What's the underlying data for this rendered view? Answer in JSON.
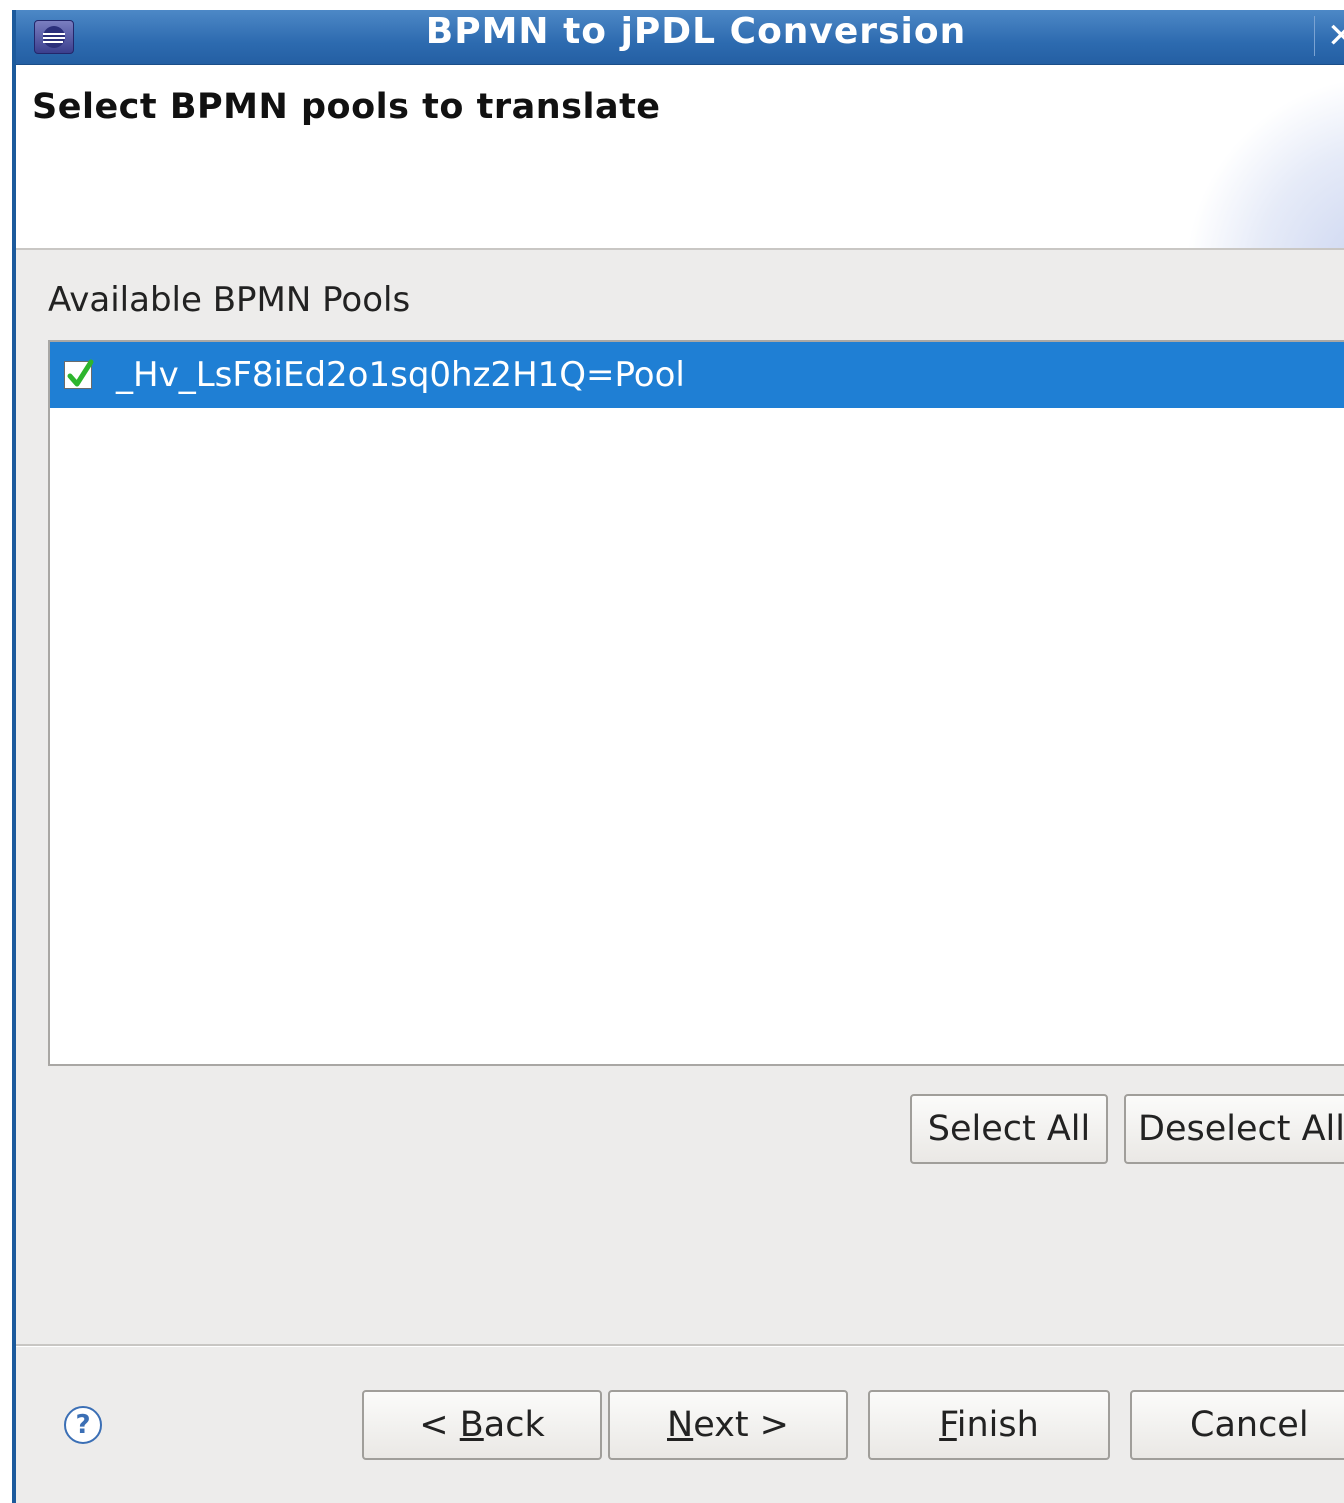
{
  "window": {
    "title": "BPMN to jPDL Conversion",
    "close_glyph": "✕"
  },
  "header": {
    "title": "Select BPMN pools to translate"
  },
  "pools": {
    "label": "Available BPMN Pools",
    "items": [
      {
        "name": "_Hv_LsF8iEd2o1sq0hz2H1Q=Pool",
        "checked": true,
        "selected": true
      }
    ]
  },
  "selection_buttons": {
    "select_all": "Select All",
    "deselect_all": "Deselect All"
  },
  "footer": {
    "help_glyph": "?",
    "back": {
      "prefix": "< ",
      "mnemonic": "B",
      "rest": "ack"
    },
    "next": {
      "prefix": "",
      "mnemonic": "N",
      "rest": "ext >"
    },
    "finish": {
      "prefix": "",
      "mnemonic": "F",
      "rest": "inish"
    },
    "cancel": "Cancel"
  },
  "colors": {
    "titlebar": "#2d6bb0",
    "selection": "#1f7fd4",
    "dialog_background": "#edeceb",
    "check_mark": "#2db52d"
  },
  "icons": {
    "window": "eclipse-window-icon",
    "close": "close-icon",
    "checkbox": "checkbox-checked-icon",
    "help": "help-icon"
  }
}
